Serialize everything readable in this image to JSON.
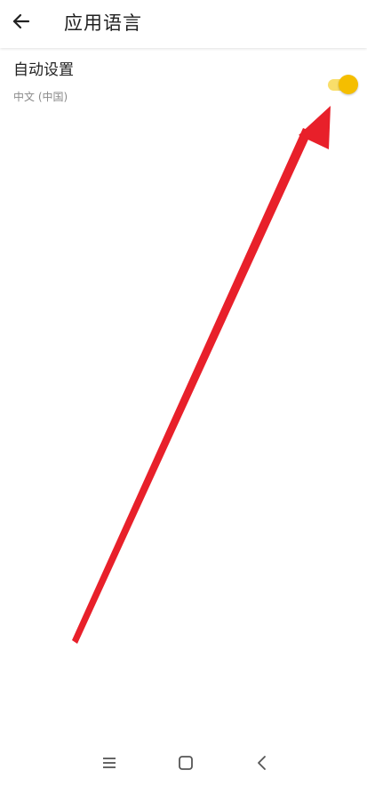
{
  "header": {
    "title": "应用语言",
    "back_icon": "arrow-left-icon"
  },
  "setting": {
    "title": "自动设置",
    "subtitle": "中文 (中国)",
    "toggle_state": "on"
  },
  "colors": {
    "accent": "#f5be00",
    "accent_track": "#f9de6a",
    "annotation": "#e8202a"
  },
  "navbar": {
    "icons": [
      "menu-icon",
      "home-icon",
      "back-chevron-icon"
    ]
  }
}
